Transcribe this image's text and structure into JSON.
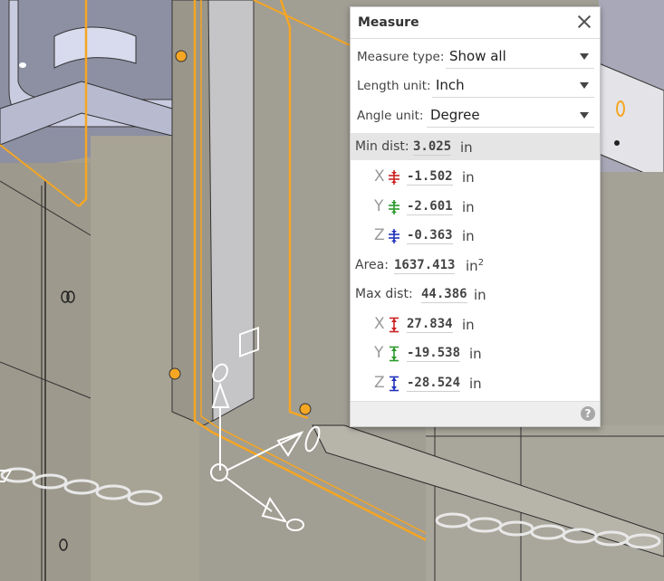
{
  "colors": {
    "accent": "#f5a623",
    "x_axis": "#cc2222",
    "y_axis": "#2a9a2a",
    "z_axis": "#2233bb"
  },
  "panel": {
    "title": "Measure",
    "measure_type": {
      "label": "Measure type:",
      "value": "Show all"
    },
    "length_unit": {
      "label": "Length unit:",
      "value": "Inch"
    },
    "angle_unit": {
      "label": "Angle unit:",
      "value": "Degree"
    },
    "min_dist": {
      "label": "Min dist:",
      "value": "3.025",
      "unit": "in",
      "x": {
        "axis": "X",
        "icon": "min-x-axis-icon",
        "value": "-1.502",
        "unit": "in"
      },
      "y": {
        "axis": "Y",
        "icon": "min-y-axis-icon",
        "value": "-2.601",
        "unit": "in"
      },
      "z": {
        "axis": "Z",
        "icon": "min-z-axis-icon",
        "value": "-0.363",
        "unit": "in"
      }
    },
    "area": {
      "label": "Area:",
      "value": "1637.413",
      "unit": "in",
      "unit_exp": "2"
    },
    "max_dist": {
      "label": "Max dist:",
      "value": "44.386",
      "unit": "in",
      "x": {
        "axis": "X",
        "icon": "max-x-axis-icon",
        "value": "27.834",
        "unit": "in"
      },
      "y": {
        "axis": "Y",
        "icon": "max-y-axis-icon",
        "value": "-19.538",
        "unit": "in"
      },
      "z": {
        "axis": "Z",
        "icon": "max-z-axis-icon",
        "value": "-28.524",
        "unit": "in"
      }
    },
    "help": "?"
  }
}
